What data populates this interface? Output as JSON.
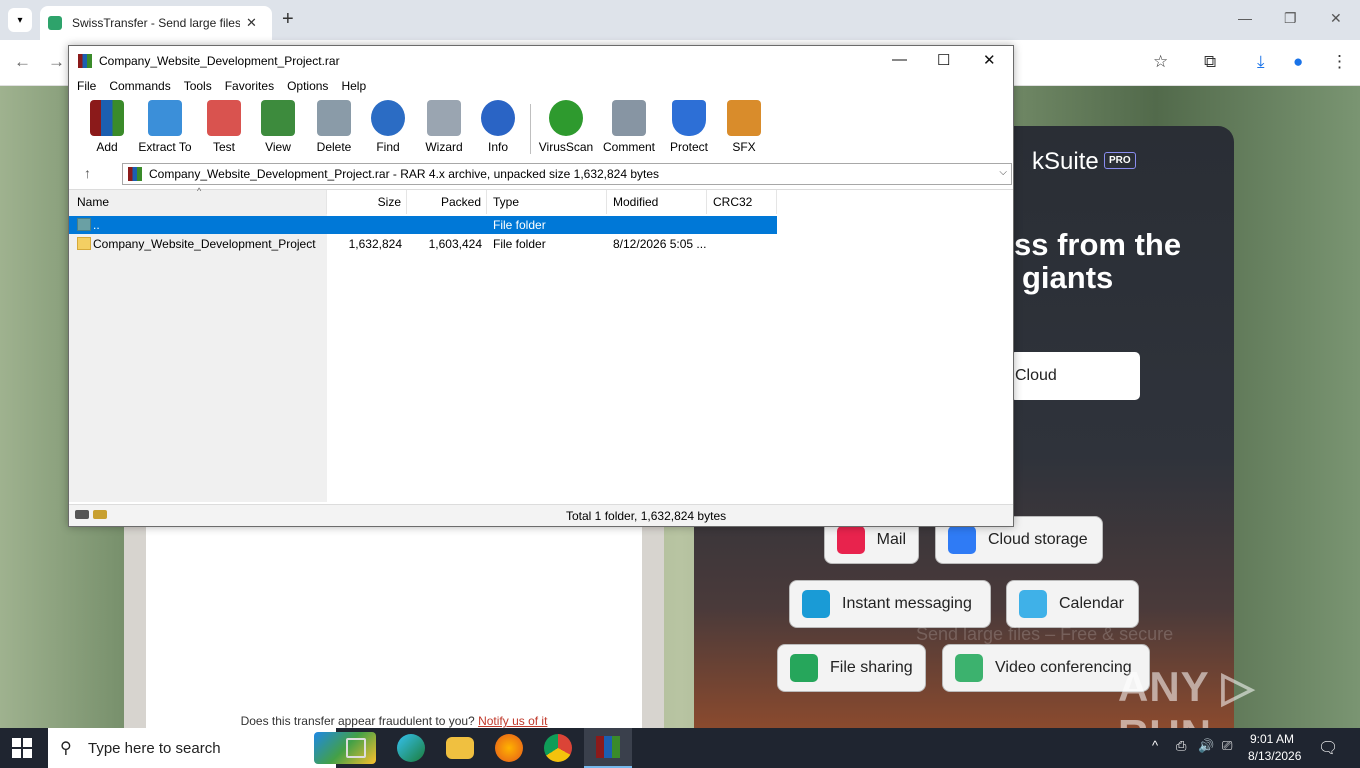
{
  "browser": {
    "tab_title": "SwissTransfer - Send large files",
    "tab_close": "✕",
    "new_tab": "+",
    "icons": {
      "back": "←",
      "forward": "→",
      "star": "☆",
      "extensions": "⧉",
      "download": "⤓",
      "profile": "●",
      "menu": "⋮"
    },
    "window_controls": {
      "minimize": "—",
      "restore": "❐",
      "close": "✕"
    }
  },
  "webpage": {
    "fraud_question": "Does this transfer appear fraudulent to you?",
    "fraud_link": "Notify us of it",
    "ksuite_logo": "kSuite",
    "pro_badge": "PRO",
    "headline_line1": "ss from the",
    "headline_line2": "giants",
    "cloud_button": "Cloud",
    "chips": [
      {
        "label": "Mail",
        "icon": "mail-icon",
        "color": "#e8234d"
      },
      {
        "label": "Cloud storage",
        "icon": "cloud-storage-icon",
        "color": "#2f7bf5"
      },
      {
        "label": "Instant messaging",
        "icon": "instant-messaging-icon",
        "color": "#1a9bd6"
      },
      {
        "label": "Calendar",
        "icon": "calendar-icon",
        "color": "#3fb1e8"
      },
      {
        "label": "File sharing",
        "icon": "file-sharing-icon",
        "color": "#26a65b"
      },
      {
        "label": "Video conferencing",
        "icon": "video-conferencing-icon",
        "color": "#3cb26e"
      }
    ],
    "background_tagline": "Send large files – Free & secure",
    "watermark": "ANY ▷ RUN"
  },
  "winrar": {
    "title": "Company_Website_Development_Project.rar",
    "window_controls": {
      "minimize": "—",
      "maximize": "☐",
      "close": "✕"
    },
    "menu": [
      "File",
      "Commands",
      "Tools",
      "Favorites",
      "Options",
      "Help"
    ],
    "toolbar": [
      {
        "label": "Add",
        "icon": "add-archive-icon",
        "color": "#c0392b"
      },
      {
        "label": "Extract To",
        "icon": "extract-to-icon",
        "color": "#3b8fd9"
      },
      {
        "label": "Test",
        "icon": "test-icon",
        "color": "#d9534f"
      },
      {
        "label": "View",
        "icon": "view-icon",
        "color": "#3d8b3d"
      },
      {
        "label": "Delete",
        "icon": "delete-icon",
        "color": "#8a9ba8"
      },
      {
        "label": "Find",
        "icon": "find-icon",
        "color": "#2b6cc4"
      },
      {
        "label": "Wizard",
        "icon": "wizard-icon",
        "color": "#9aa5b1"
      },
      {
        "label": "Info",
        "icon": "info-icon",
        "color": "#2a64c5"
      },
      {
        "label": "VirusScan",
        "icon": "virus-scan-icon",
        "color": "#2e9a2e"
      },
      {
        "label": "Comment",
        "icon": "comment-icon",
        "color": "#8795a3"
      },
      {
        "label": "Protect",
        "icon": "protect-icon",
        "color": "#2d6fd6"
      },
      {
        "label": "SFX",
        "icon": "sfx-icon",
        "color": "#d98c2b"
      }
    ],
    "up_arrow": "↑",
    "path": "Company_Website_Development_Project.rar - RAR 4.x archive, unpacked size 1,632,824 bytes",
    "path_dropdown": "⌵",
    "sort_caret": "^",
    "columns": [
      "Name",
      "Size",
      "Packed",
      "Type",
      "Modified",
      "CRC32"
    ],
    "rows": [
      {
        "name": "..",
        "size": "",
        "packed": "",
        "type": "File folder",
        "modified": "",
        "crc": ""
      },
      {
        "name": "Company_Website_Development_Project",
        "size": "1,632,824",
        "packed": "1,603,424",
        "type": "File folder",
        "modified": "8/12/2026 5:05 ...",
        "crc": ""
      }
    ],
    "status": "Total 1 folder, 1,632,824 bytes"
  },
  "taskbar": {
    "search_placeholder": "Type here to search",
    "search_icon": "⚲",
    "tray_chevron": "^",
    "tray_icons": {
      "meet": "⎙",
      "volume": "🔊",
      "network": "⎚"
    },
    "time": "9:01 AM",
    "date": "8/13/2026",
    "notifications": "🗨"
  }
}
